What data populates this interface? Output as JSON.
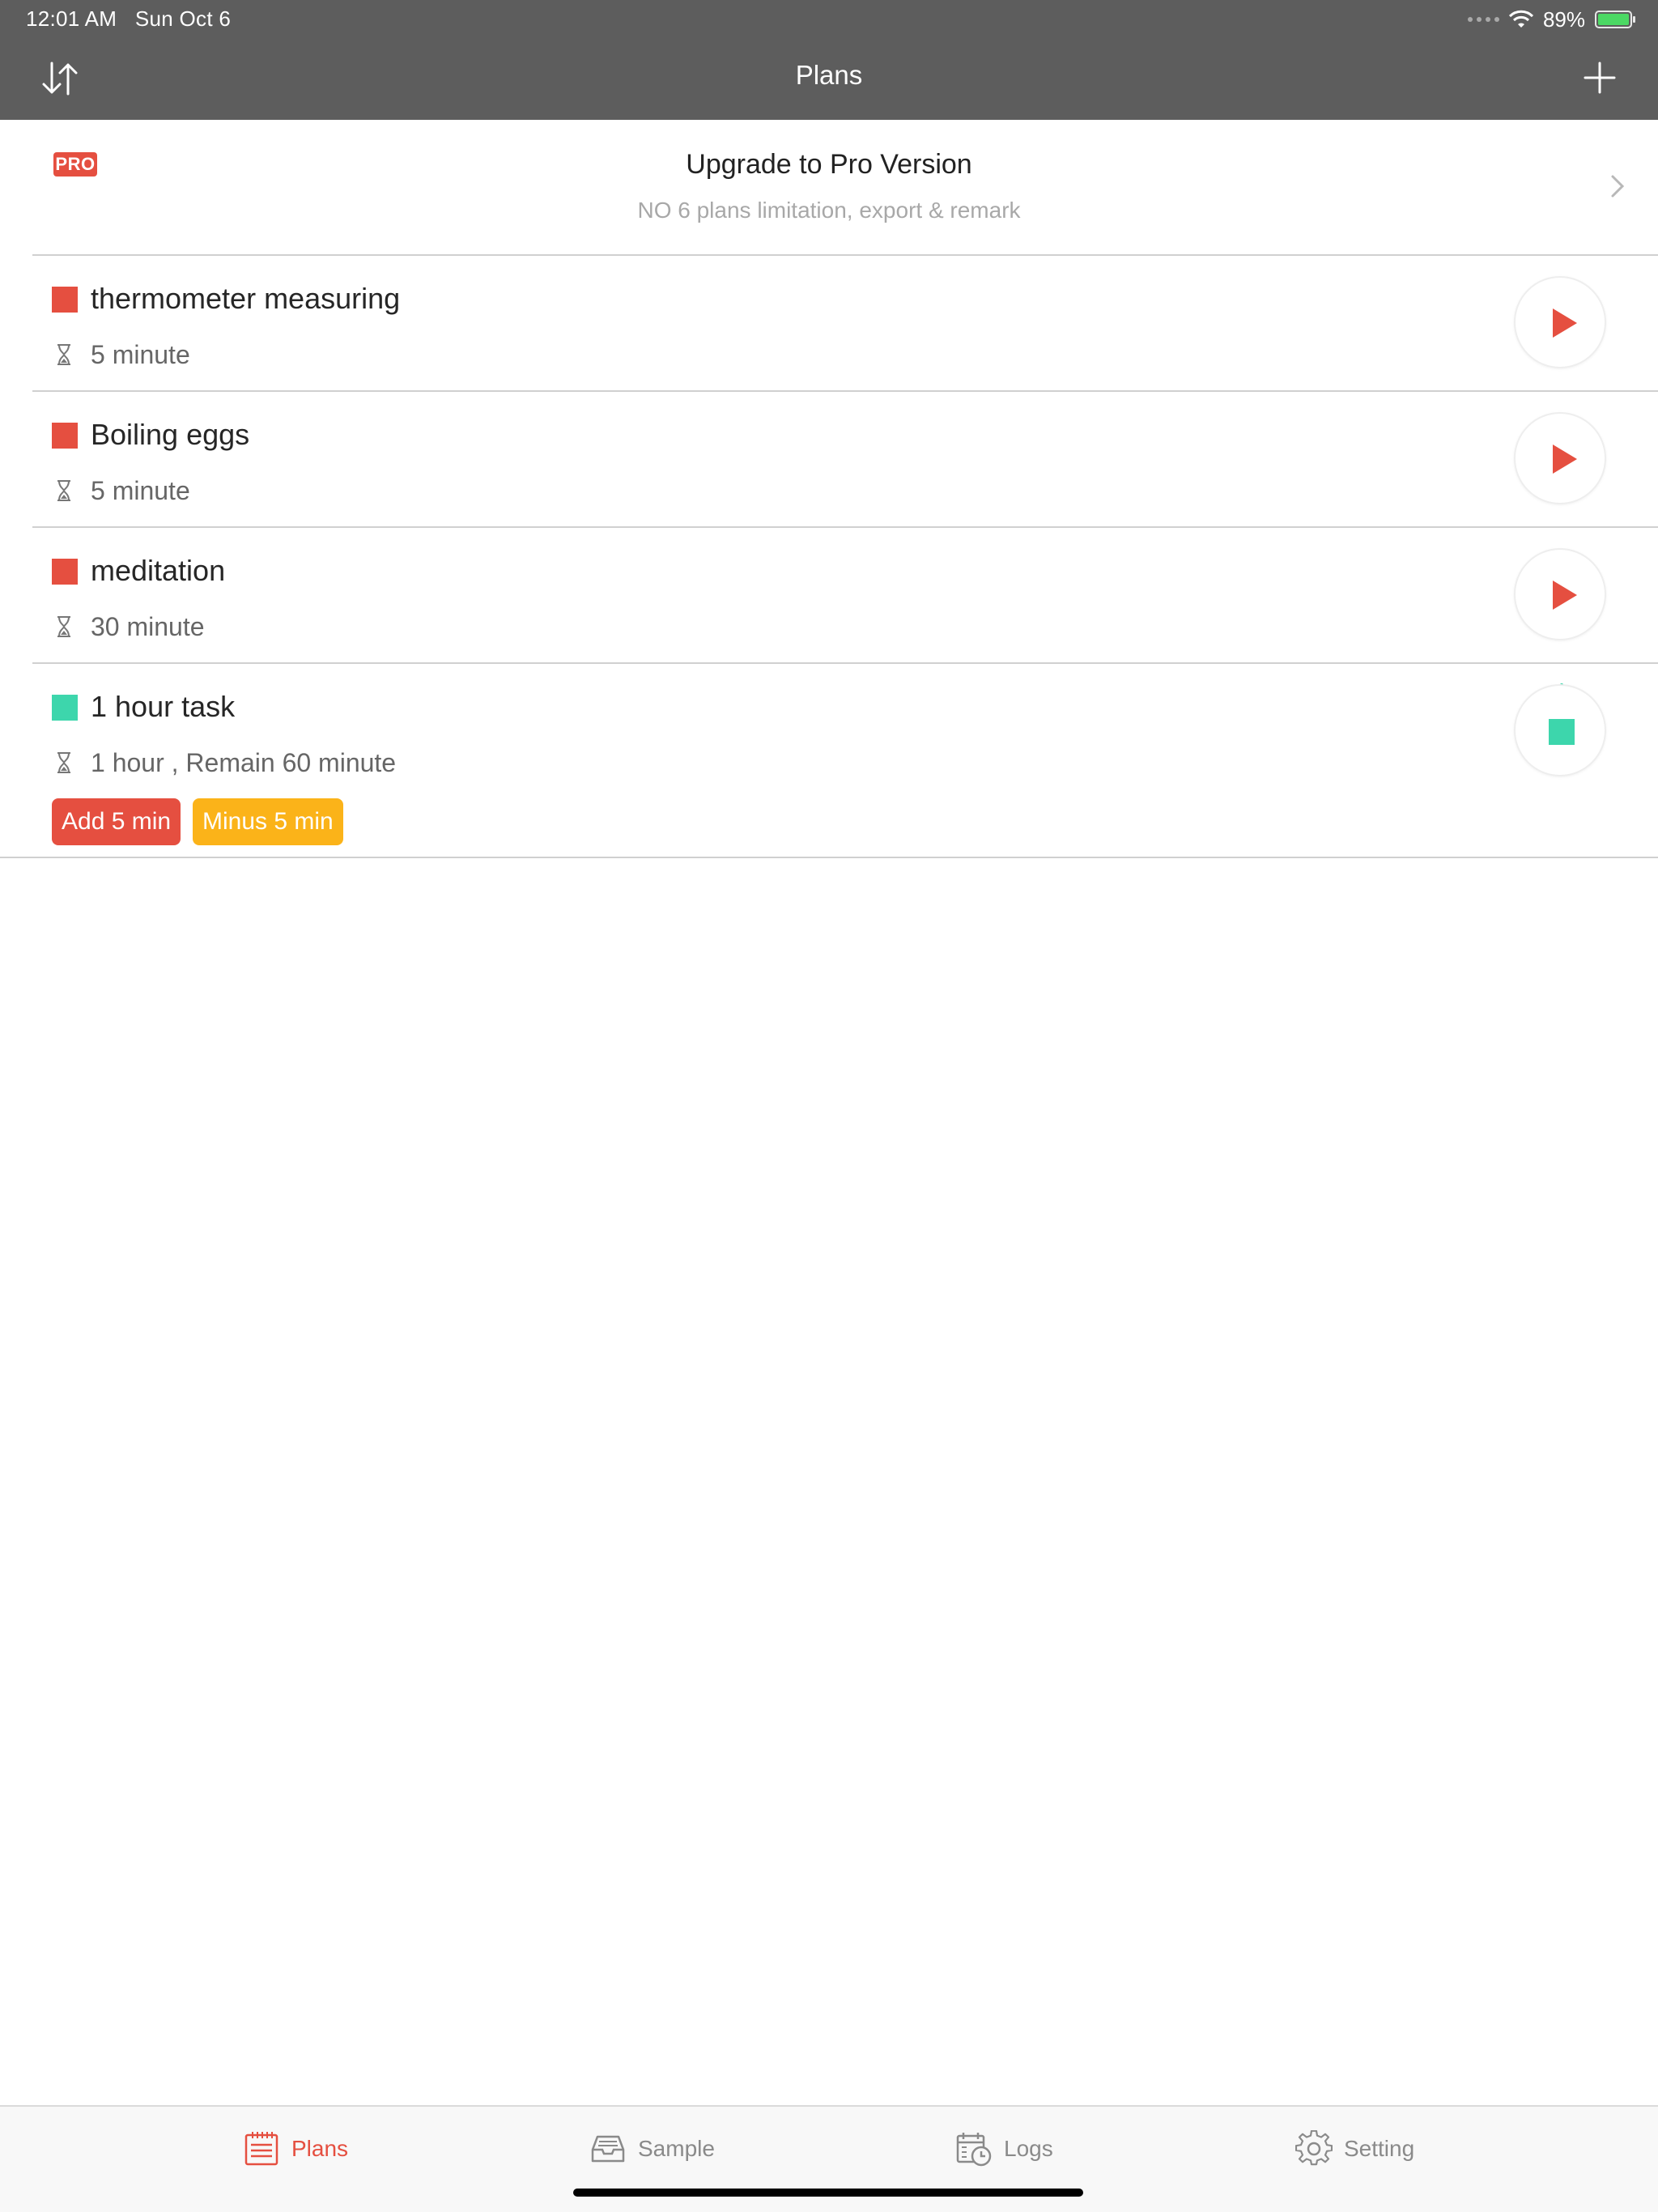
{
  "status_bar": {
    "time": "12:01 AM",
    "date": "Sun Oct 6",
    "battery": "89%"
  },
  "nav": {
    "title": "Plans"
  },
  "upgrade": {
    "badge": "PRO",
    "title": "Upgrade to Pro Version",
    "subtitle": "NO 6 plans limitation, export & remark"
  },
  "plans": [
    {
      "name": "thermometer measuring",
      "duration": "5 minute",
      "color": "#e54f40",
      "state": "stopped"
    },
    {
      "name": "Boiling eggs",
      "duration": "5 minute",
      "color": "#e54f40",
      "state": "stopped"
    },
    {
      "name": "meditation",
      "duration": "30 minute",
      "color": "#e54f40",
      "state": "stopped"
    },
    {
      "name": "1 hour task",
      "duration": "1 hour , Remain 60 minute",
      "color": "#3dd6ac",
      "state": "running",
      "actions": {
        "add_label": "Add 5 min",
        "minus_label": "Minus 5 min"
      }
    }
  ],
  "tabs": [
    {
      "label": "Plans",
      "icon": "list-icon",
      "active": true
    },
    {
      "label": "Sample",
      "icon": "inbox-icon",
      "active": false
    },
    {
      "label": "Logs",
      "icon": "calendar-clock-icon",
      "active": false
    },
    {
      "label": "Setting",
      "icon": "gear-icon",
      "active": false
    }
  ],
  "colors": {
    "accent": "#e54f40",
    "running": "#3dd6ac",
    "warning": "#fbb319",
    "nav_bg": "#5d5d5d"
  }
}
